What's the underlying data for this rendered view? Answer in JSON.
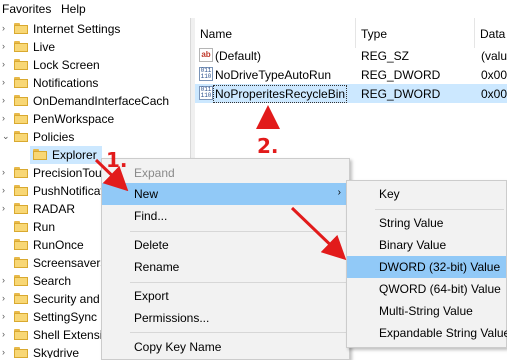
{
  "menubar": {
    "favorites": "Favorites",
    "help": "Help"
  },
  "tree": {
    "items": [
      {
        "label": "Internet Settings"
      },
      {
        "label": "Live"
      },
      {
        "label": "Lock Screen"
      },
      {
        "label": "Notifications"
      },
      {
        "label": "OnDemandInterfaceCach"
      },
      {
        "label": "PenWorkspace"
      },
      {
        "label": "Policies"
      },
      {
        "label": "Explorer"
      },
      {
        "label": "PrecisionTou"
      },
      {
        "label": "PushNotificat"
      },
      {
        "label": "RADAR"
      },
      {
        "label": "Run"
      },
      {
        "label": "RunOnce"
      },
      {
        "label": "Screensavers"
      },
      {
        "label": "Search"
      },
      {
        "label": "Security and"
      },
      {
        "label": "SettingSync"
      },
      {
        "label": "Shell Extensi"
      },
      {
        "label": "Skydrive"
      }
    ]
  },
  "columns": {
    "name": "Name",
    "type": "Type",
    "data": "Data"
  },
  "values": [
    {
      "name": "(Default)",
      "type": "REG_SZ",
      "data": "(valu",
      "icon": "string-value-icon"
    },
    {
      "name": "NoDriveTypeAutoRun",
      "type": "REG_DWORD",
      "data": "0x00",
      "icon": "binary-value-icon"
    },
    {
      "name": "NoProperitesRecycleBin",
      "type": "REG_DWORD",
      "data": "0x00",
      "icon": "binary-value-icon"
    }
  ],
  "context_menu": {
    "items": {
      "expand": "Expand",
      "new": "New",
      "find": "Find...",
      "delete": "Delete",
      "rename": "Rename",
      "export": "Export",
      "permissions": "Permissions...",
      "copy_key_name": "Copy Key Name"
    }
  },
  "submenu": {
    "items": {
      "key": "Key",
      "string_value": "String Value",
      "binary_value": "Binary Value",
      "dword_value": "DWORD (32-bit) Value",
      "qword_value": "QWORD (64-bit) Value",
      "multi_string_value": "Multi-String Value",
      "expandable_string_value": "Expandable String Value"
    }
  },
  "annotations": {
    "step1": "1.",
    "step2": "2."
  },
  "colors": {
    "highlight": "#91c9f7",
    "selected": "#cce8ff",
    "annotation": "#e21b1b"
  }
}
